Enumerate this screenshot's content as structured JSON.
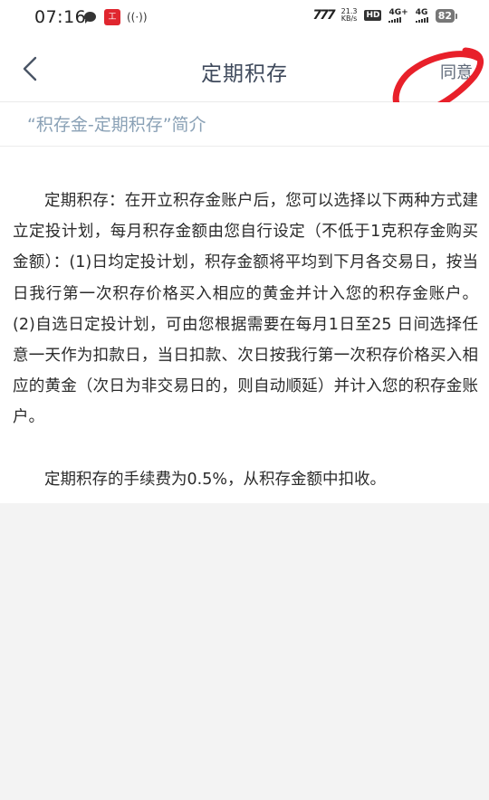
{
  "status_bar": {
    "time": "07:16",
    "bank_badge": "工",
    "hotspot": "((·))",
    "carrier_logo": "777",
    "speed_value": "21.3",
    "speed_unit": "KB/s",
    "hd_label": "HD",
    "net1": "4G+",
    "net2": "4G",
    "battery": "82"
  },
  "nav": {
    "title": "定期积存",
    "agree_label": "同意"
  },
  "section": {
    "title": "“积存金-定期积存”简介"
  },
  "content": {
    "paragraph_1": "定期积存：在开立积存金账户后，您可以选择以下两种方式建立定投计划，每月积存金额由您自行设定（不低于1克积存金购买金额）：(1)日均定投计划，积存金额将平均到下月各交易日，按当日我行第一次积存价格买入相应的黄金并计入您的积存金账户。(2)自选日定投计划，可由您根据需要在每月1日至25 日间选择任意一天作为扣款日，当日扣款、次日按我行第一次积存价格买入相应的黄金（次日为非交易日的，则自动顺延）并计入您的积存金账户。",
    "paragraph_2": "定期积存的手续费为0.5%，从积存金额中扣收。"
  },
  "colors": {
    "title": "#3f4a5c",
    "section_title": "#8aa1b6",
    "annotation": "#e8202a",
    "page_background": "#f3f3f3"
  }
}
